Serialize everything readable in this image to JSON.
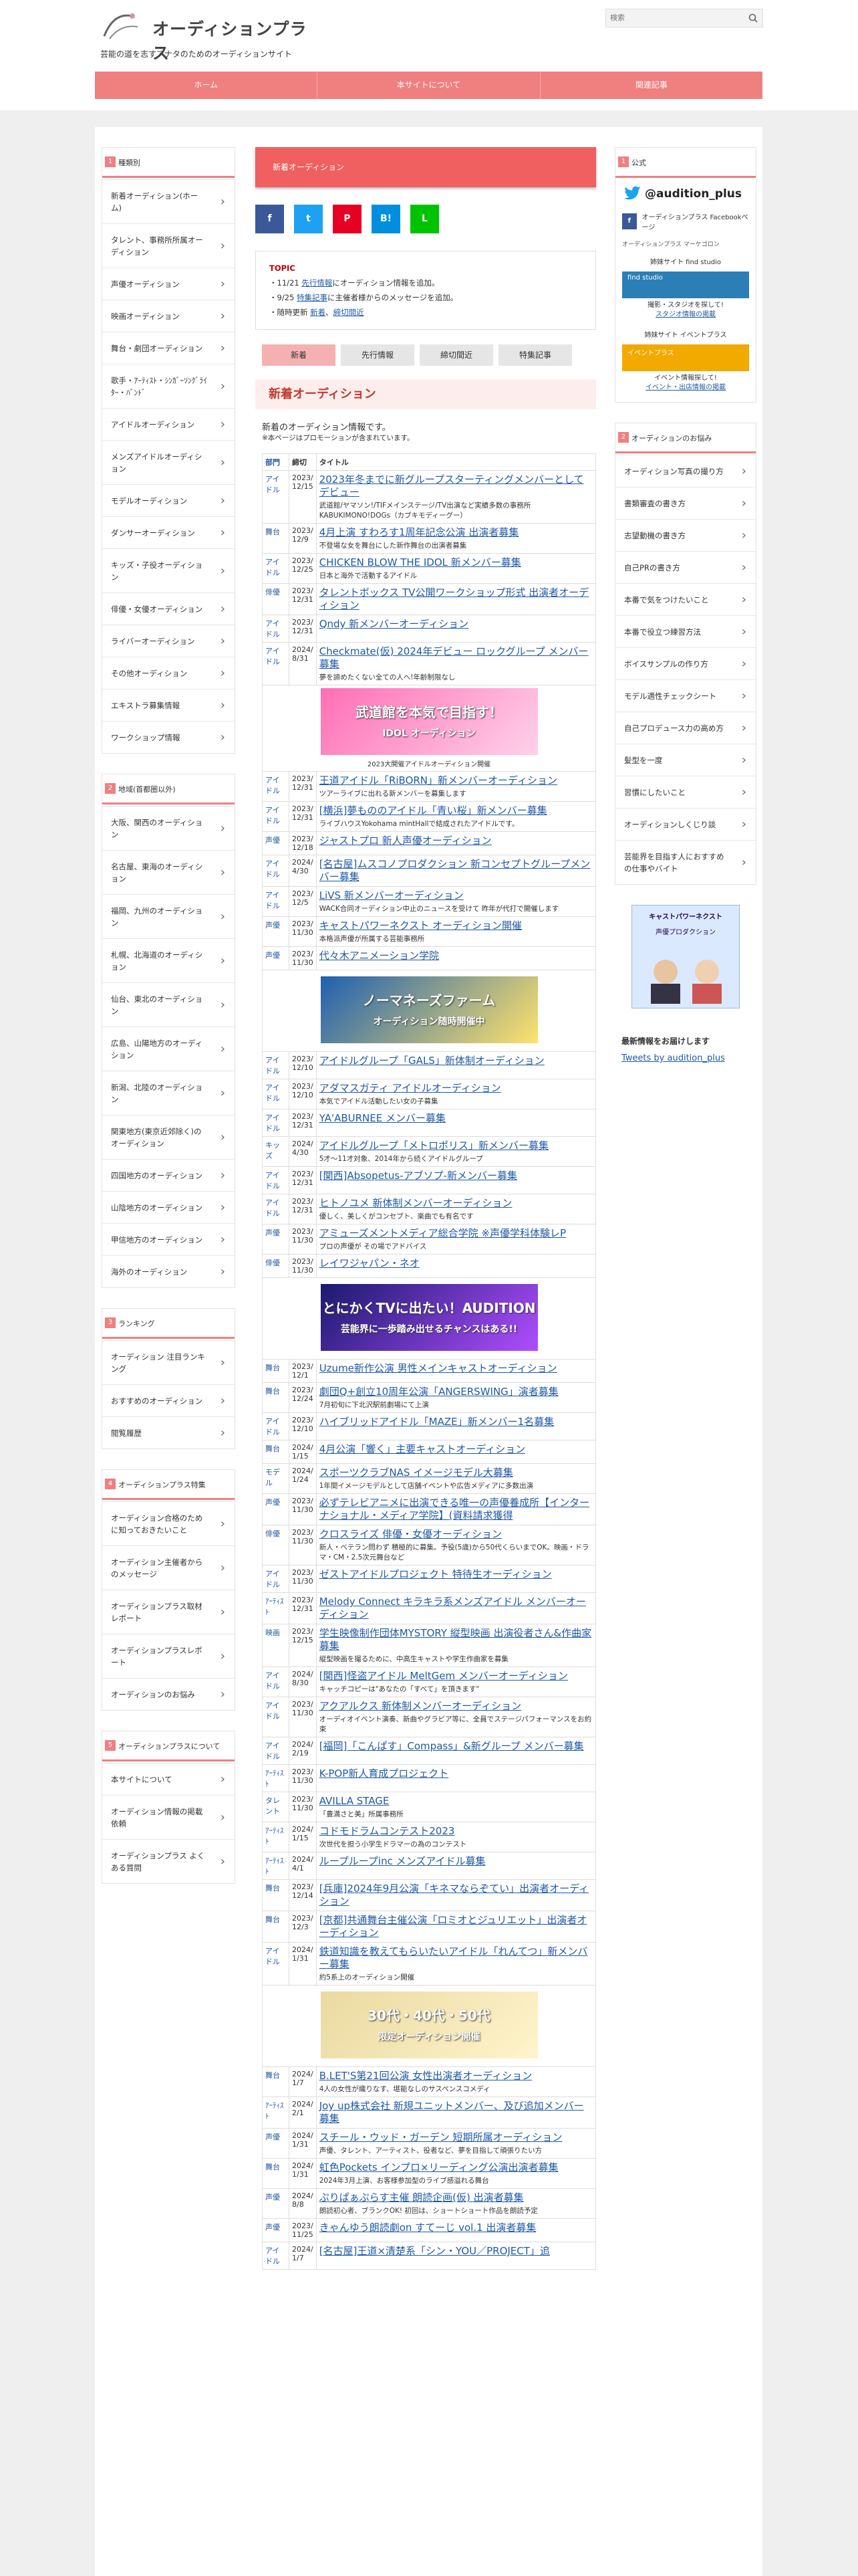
{
  "header": {
    "site_name": "オーディションプラス",
    "tagline": "芸能の道を志すアナタのためのオーディションサイト",
    "search_placeholder": "検索"
  },
  "gnav": [
    "ホーム",
    "本サイトについて",
    "関連記事"
  ],
  "left_boxes": [
    {
      "num": "1",
      "title": "種類別",
      "items": [
        "新着オーディション(ホーム)",
        "タレント、事務所所属オーディション",
        "声優オーディション",
        "映画オーディション",
        "舞台・劇団オーディション",
        "歌手・ｱｰﾃｨｽﾄ・ｼﾝｶﾞｰｿﾝｸﾞﾗｲﾀｰ・ﾊﾞﾝﾄﾞ",
        "アイドルオーディション",
        "メンズアイドルオーディション",
        "モデルオーディション",
        "ダンサーオーディション",
        "キッズ・子役オーディション",
        "俳優・女優オーディション",
        "ライバーオーディション",
        "その他オーディション",
        "エキストラ募集情報",
        "ワークショップ情報"
      ]
    },
    {
      "num": "2",
      "title": "地域(首都圏以外)",
      "items": [
        "大阪、関西のオーディション",
        "名古屋、東海のオーディション",
        "福岡、九州のオーディション",
        "札幌、北海道のオーディション",
        "仙台、東北のオーディション",
        "広島、山陽地方のオーディション",
        "新潟、北陸のオーディション",
        "関東地方(東京近郊除く)のオーディション",
        "四国地方のオーディション",
        "山陰地方のオーディション",
        "甲信地方のオーディション",
        "海外のオーディション"
      ]
    },
    {
      "num": "3",
      "title": "ランキング",
      "items": [
        "オーディション 注目ランキング",
        "おすすめのオーディション",
        "閲覧履歴"
      ]
    },
    {
      "num": "4",
      "title": "オーディションプラス特集",
      "items": [
        "オーディション合格のために知っておきたいこと",
        "オーディション主催者からのメッセージ",
        "オーディションプラス取材レポート",
        "オーディションプラスレポート",
        "オーディションのお悩み"
      ]
    },
    {
      "num": "5",
      "title": "オーディションプラスについて",
      "items": [
        "本サイトについて",
        "オーディション情報の掲載依頼",
        "オーディションプラス よくある質問"
      ]
    }
  ],
  "main": {
    "category_bar": "新着オーディション",
    "share": [
      "f",
      "t",
      "P",
      "B!",
      "L"
    ],
    "topic": {
      "heading": "TOPIC",
      "items": [
        {
          "pre": "・11/21 ",
          "link": "先行情報",
          "post": "にオーディション情報を追加。"
        },
        {
          "pre": "・9/25 ",
          "link": "特集記事",
          "post": "に主催者様からのメッセージを追加。"
        }
      ],
      "update_pre": "・随時更新 ",
      "update_link1": "新着",
      "update_sep": "、",
      "update_link2": "締切間近"
    },
    "tabs": [
      "新着",
      "先行情報",
      "締切間近",
      "特集記事"
    ],
    "section_title": "新着オーディション",
    "intro": "新着のオーディション情報です。",
    "note": "※本ページはプロモーションが含まれています。",
    "table_head": [
      "部門",
      "締切",
      "タイトル"
    ],
    "rows": [
      {
        "cat": "アイドル",
        "date": "2023/ 12/15",
        "title": "2023年冬までに新グループスターティングメンバーとしてデビュー",
        "sub": "武道館/ヤマソン!/TIFメインステージ/TV出演など実績多数の事務所KABUKIMONO!DOGs（カブキモディーグー）"
      },
      {
        "cat": "舞台",
        "date": "2023/ 12/9",
        "title": "4月上演 すわろす1周年記念公演 出演者募集",
        "sub": "不登場な女を舞台にした新作舞台の出演者募集"
      },
      {
        "cat": "アイドル",
        "date": "2023/ 12/25",
        "title": "CHICKEN BLOW THE IDOL 新メンバー募集",
        "sub": "日本と海外で活動するアイドル"
      },
      {
        "cat": "俳優",
        "date": "2023/ 12/31",
        "title": "タレントボックス TV公開ワークショップ形式 出演者オーディション",
        "sub": ""
      },
      {
        "cat": "アイドル",
        "date": "2023/ 12/31",
        "title": "Qndy 新メンバーオーディション",
        "sub": ""
      },
      {
        "cat": "アイドル",
        "date": "2024/ 8/31",
        "title": "Checkmate(仮) 2024年デビュー ロックグループ メンバー募集",
        "sub": "夢を諦めたくない全ての人へ!年齢制限なし"
      },
      {
        "ad": true,
        "ad_text": "武道館を本気で目指す！",
        "ad_sub": "IDOL オーディション",
        "ad_cap": "2023大開催アイドルオーディション開催"
      },
      {
        "cat": "アイドル",
        "date": "2023/ 12/31",
        "title": "王道アイドル「RiBORN」新メンバーオーディション",
        "sub": "ツアーライブに出れる新メンバーを募集します"
      },
      {
        "cat": "アイドル",
        "date": "2023/ 12/31",
        "title": "[横浜]夢もののアイドル「青い桜」新メンバー募集",
        "sub": "ライブハウスYokohama mintHallで結成されたアイドルです。"
      },
      {
        "cat": "声優",
        "date": "2023/ 12/18",
        "title": "ジャストプロ 新人声優オーディション",
        "sub": ""
      },
      {
        "cat": "アイドル",
        "date": "2024/ 4/30",
        "title": "[名古屋]ムスコノプロダクション 新コンセプトグループメンバー募集",
        "sub": ""
      },
      {
        "cat": "アイドル",
        "date": "2023/ 12/5",
        "title": "LiVS 新メンバーオーディション",
        "sub": "WACK合同オーディション中止のニュースを受けて 昨年が代打で開催します"
      },
      {
        "cat": "声優",
        "date": "2023/ 11/30",
        "title": "キャストパワーネクスト オーディション開催",
        "sub": "本格派声優が所属する芸能事務所"
      },
      {
        "cat": "声優",
        "date": "2023/ 11/30",
        "title": "代々木アニメーション学院",
        "sub": ""
      },
      {
        "ad": true,
        "ad_text": "ノーマネーズファーム",
        "ad_sub": "オーディション随時開催中",
        "ad_cap": ""
      },
      {
        "cat": "アイドル",
        "date": "2023/ 12/10",
        "title": "アイドルグループ「GALS」新体制オーディション",
        "sub": ""
      },
      {
        "cat": "アイドル",
        "date": "2023/ 12/10",
        "title": "アダマスガティ アイドルオーディション",
        "sub": "本気でアイドル活動したい女の子募集"
      },
      {
        "cat": "アイドル",
        "date": "2023/ 12/31",
        "title": "YA'ABURNEE メンバー募集",
        "sub": ""
      },
      {
        "cat": "キッズ",
        "date": "2024/ 4/30",
        "title": "アイドルグループ「メトロポリス」新メンバー募集",
        "sub": "5才〜11才対象、2014年から続くアイドルグループ"
      },
      {
        "cat": "アイドル",
        "date": "2023/ 12/31",
        "title": "[関西]Absopetus-アブソプ-新メンバー募集",
        "sub": ""
      },
      {
        "cat": "アイドル",
        "date": "2023/ 12/31",
        "title": "ヒトノユメ 新体制メンバーオーディション",
        "sub": "優しく、美しくがコンセプト、楽曲でも有名です"
      },
      {
        "cat": "声優",
        "date": "2023/ 11/30",
        "title": "アミューズメントメディア総合学院 ※声優学科体験レP",
        "sub": "プロの声優が その場でアドバイス"
      },
      {
        "cat": "俳優",
        "date": "2023/ 11/30",
        "title": "レイワジャパン・ネオ",
        "sub": ""
      },
      {
        "ad": true,
        "ad_text": "とにかくTVに出たい！AUDITION",
        "ad_sub": "芸能界に一歩踏み出せるチャンスはある!!",
        "ad_cap": ""
      },
      {
        "cat": "舞台",
        "date": "2023/ 12/1",
        "title": "Uzume新作公演 男性メインキャストオーディション",
        "sub": ""
      },
      {
        "cat": "舞台",
        "date": "2023/ 12/24",
        "title": "劇団Q+創立10周年公演「ANGERSWING」演者募集",
        "sub": "7月初旬に下北沢駅前劇場にて上演"
      },
      {
        "cat": "アイドル",
        "date": "2023/ 12/10",
        "title": "ハイブリッドアイドル「MAZE」新メンバー1名募集",
        "sub": ""
      },
      {
        "cat": "舞台",
        "date": "2024/ 1/15",
        "title": "4月公演「響く」主要キャストオーディション",
        "sub": ""
      },
      {
        "cat": "モデル",
        "date": "2024/ 1/24",
        "title": "スポーツクラブNAS イメージモデル大募集",
        "sub": "1年間イメージモデルとして店舗イベントや広告メディアに多数出演"
      },
      {
        "cat": "声優",
        "date": "2023/ 11/30",
        "title": "必ずテレビアニメに出演できる唯一の声優養成所【インターナショナル・メディア学院】(資料請求獲得",
        "sub": ""
      },
      {
        "cat": "俳優",
        "date": "2023/ 11/30",
        "title": "クロスライズ 俳優・女優オーディション",
        "sub": "新人・ベテラン問わず 積極的に募集。予役(5歳)から50代くらいまでOK。映画・ドラマ・CM・2.5次元舞台など"
      },
      {
        "cat": "アイドル",
        "date": "2023/ 11/30",
        "title": "ゼストアイドルプロジェクト 特待生オーディション",
        "sub": ""
      },
      {
        "cat": "ｱｰﾃｨｽﾄ",
        "date": "2023/ 12/31",
        "title": "Melody Connect キラキラ系メンズアイドル メンバーオーディション",
        "sub": ""
      },
      {
        "cat": "映画",
        "date": "2023/ 12/15",
        "title": "学生映像制作団体MYSTORY 縦型映画 出演役者さん&作曲家募集",
        "sub": "縦型映画を撮るために、中高生キャストや学生作曲家を募集"
      },
      {
        "cat": "アイドル",
        "date": "2024/ 8/30",
        "title": "[関西]怪盗アイドル MeltGem メンバーオーディション",
        "sub": "キャッチコピーは\"あなたの「すべて」を頂きます\""
      },
      {
        "cat": "アイドル",
        "date": "2023/ 11/30",
        "title": "アクアルクス 新体制メンバーオーディション",
        "sub": "オーディオイベント演奏、新曲やグラビア等に、全員でステージパフォーマンスをお約束"
      },
      {
        "cat": "アイドル",
        "date": "2024/ 2/19",
        "title": "[福岡]「こんぱす」Compass」&新グループ メンバー募集",
        "sub": ""
      },
      {
        "cat": "ｱｰﾃｨｽﾄ",
        "date": "2023/ 11/30",
        "title": "K-POP新人育成プロジェクト",
        "sub": ""
      },
      {
        "cat": "タレント",
        "date": "2023/ 11/30",
        "title": "AVILLA STAGE",
        "sub": "「豊満さと美」所属事務所"
      },
      {
        "cat": "ｱｰﾃｨｽﾄ",
        "date": "2024/ 1/15",
        "title": "コドモドラムコンテスト2023",
        "sub": "次世代を担う小学生ドラマーの為のコンテスト"
      },
      {
        "cat": "ｱｰﾃｨｽﾄ",
        "date": "2024/ 4/1",
        "title": "ループループinc メンズアイドル募集",
        "sub": ""
      },
      {
        "cat": "舞台",
        "date": "2023/ 12/14",
        "title": "[兵庫]2024年9月公演「キネマならぞてい」出演者オーディション",
        "sub": ""
      },
      {
        "cat": "舞台",
        "date": "2023/ 12/3",
        "title": "[京都]共通舞台主催公演「ロミオとジュリエット」出演者オーディション",
        "sub": ""
      },
      {
        "cat": "アイドル",
        "date": "2024/ 1/31",
        "title": "鉄道知識を教えてもらいたいアイドル「れんてつ」新メンバー募集",
        "sub": "約5系上のオーディション開催"
      },
      {
        "ad": true,
        "ad_text": "30代・40代・50代",
        "ad_sub": "限定オーディション開催",
        "ad_cap": ""
      },
      {
        "cat": "舞台",
        "date": "2024/ 1/7",
        "title": "B.LET'S第21回公演 女性出演者オーディション",
        "sub": "4人の女性が織りなす、堪能なしのサスペンスコメディ"
      },
      {
        "cat": "ｱｰﾃｨｽﾄ",
        "date": "2024/ 2/1",
        "title": "Joy up株式会社 新規ユニットメンバー、及び追加メンバー募集",
        "sub": ""
      },
      {
        "cat": "声優",
        "date": "2024/ 1/31",
        "title": "スチール・ウッド・ガーデン 短期所属オーディション",
        "sub": "声優、タレント、アーティスト、役者など、夢を目指して頑張りたい方"
      },
      {
        "cat": "舞台",
        "date": "2024/ 1/31",
        "title": "虹色Pockets インプロ×リーディング公演出演者募集",
        "sub": "2024年3月上演、お客様参加型のライブ感溢れる舞台"
      },
      {
        "cat": "声優",
        "date": "2024/ 8/8",
        "title": "ぷりぱぁぷらす主催 朗読企画(仮) 出演者募集",
        "sub": "朗読初心者、ブランクOK! 初回は、ショートショート作品を朗読予定"
      },
      {
        "cat": "声優",
        "date": "2023/ 11/25",
        "title": "きゃんゆう朗読劇on すてーじ vol.1 出演者募集",
        "sub": ""
      },
      {
        "cat": "アイドル",
        "date": "2024/ 1/7",
        "title": "[名古屋]王道×清楚系「シン・YOU／PROJECT」追",
        "sub": ""
      }
    ]
  },
  "right": {
    "box1_num": "1",
    "box1_title": "公式",
    "twitter": "@audition_plus",
    "fb_label": "オーディションプラス Facebookページ",
    "bubble": "オーディションプラス マーケゴロン",
    "site1_title": "姉妹サイト find studio",
    "site1_btn": "find studio",
    "site1_cap": "撮影・スタジオを探して!",
    "site1_link": "スタジオ情報の掲載",
    "site2_title": "姉妹サイト イベントプラス",
    "site2_btn": "イベントプラス",
    "site2_cap": "イベント情報探して!",
    "site2_link": "イベント・出店情報の掲載",
    "box2_num": "2",
    "box2_title": "オーディションのお悩み",
    "tips": [
      "オーディション写真の撮り方",
      "書類審査の書き方",
      "志望動機の書き方",
      "自己PRの書き方",
      "本番で気をつけたいこと",
      "本番で役立つ練習方法",
      "ボイスサンプルの作り方",
      "モデル適性チェックシート",
      "自己プロデュース力の高め方",
      "髪型を一度",
      "習慣にしたいこと",
      "オーディションしくじり談",
      "芸能界を目指す人におすすめの仕事やバイト"
    ],
    "banner_title": "キャストパワーネクスト",
    "banner_sub": "声優プロダクション",
    "tweets_title": "最新情報をお届けします",
    "tweets_link": "Tweets by audition_plus"
  },
  "colors": {
    "accent": "#f07f80",
    "link": "#1f5aa6",
    "cat_bar": "#f06060"
  }
}
